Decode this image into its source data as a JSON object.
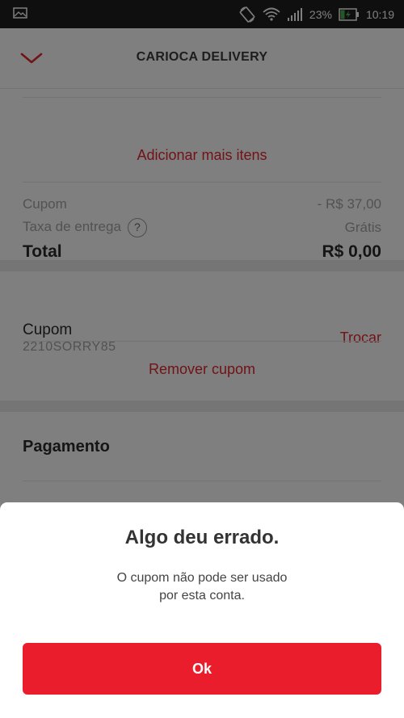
{
  "status_bar": {
    "battery": "23%",
    "time": "10:19"
  },
  "header": {
    "title": "CARIOCA DELIVERY"
  },
  "order": {
    "add_more_label": "Adicionar mais itens",
    "coupon_label": "Cupom",
    "coupon_value": "- R$ 37,00",
    "delivery_fee_label": "Taxa de entrega",
    "delivery_fee_help": "?",
    "delivery_fee_value": "Grátis",
    "total_label": "Total",
    "total_value": "R$ 0,00"
  },
  "coupon_section": {
    "title": "Cupom",
    "code": "2210SORRY85",
    "change_label": "Trocar",
    "remove_label": "Remover cupom"
  },
  "payment_section": {
    "title": "Pagamento"
  },
  "modal": {
    "title": "Algo deu errado.",
    "message_line1": "O cupom não pode ser usado",
    "message_line2": "por esta conta.",
    "ok_label": "Ok"
  },
  "colors": {
    "accent": "#ea1d2c",
    "link": "#e3262e"
  }
}
